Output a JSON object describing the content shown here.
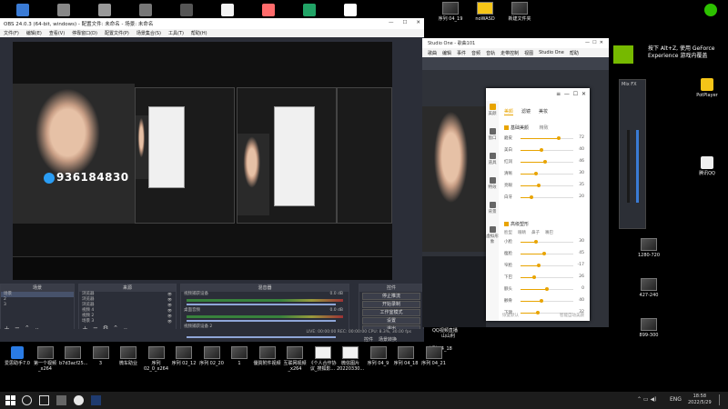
{
  "desktop_top": [
    {
      "label": "",
      "color": "#3a7bd5"
    },
    {
      "label": "",
      "color": "#888"
    },
    {
      "label": "",
      "color": "#999"
    },
    {
      "label": "",
      "color": "#777"
    },
    {
      "label": "",
      "color": "#555"
    },
    {
      "label": "",
      "color": "#f2f2f2"
    },
    {
      "label": "",
      "color": "#ff6b6b"
    },
    {
      "label": "",
      "color": "#21a366"
    },
    {
      "label": "",
      "color": "#ffffff"
    }
  ],
  "desktop_top_right": [
    {
      "label": "序列 04_19"
    },
    {
      "label": "noWASD"
    },
    {
      "label": "新建文件夹"
    }
  ],
  "obs": {
    "title": "OBS 24.0.3 (64-bit, windows) - 配置文件: 未命名 - 场景: 未命名",
    "menu": [
      "文件(F)",
      "编辑(E)",
      "查看(V)",
      "停靠窗口(D)",
      "配置文件(P)",
      "场景集合(S)",
      "工具(T)",
      "帮助(H)"
    ],
    "overlay_text": "936184830",
    "docks": {
      "scenes_title": "场景",
      "sources_title": "来源",
      "mixer_title": "混音器",
      "controls_title": "控件",
      "scenes": [
        "场景",
        "2",
        "3"
      ],
      "sources": [
        "浏览器",
        "浏览器",
        "浏览器",
        "视频 4",
        "视频 2",
        "场景 3"
      ],
      "mixer": [
        {
          "name": "视频捕获设备",
          "value": "0.0 dB"
        },
        {
          "name": "桌面音频",
          "value": "0.0 dB"
        },
        {
          "name": "视频捕获设备 2",
          "value": ""
        }
      ],
      "controls": [
        "停止推流",
        "开始录制",
        "工作室模式",
        "设置",
        "退出"
      ],
      "bottom_tabs": [
        "控件",
        "场景转换"
      ]
    },
    "status": "LIVE: 00:00:00   REC: 00:00:00   CPU: 8.3%, 30.00 fps"
  },
  "studio": {
    "title": "Studio One - 歌曲101",
    "menu": [
      "歌曲",
      "编辑",
      "事件",
      "音频",
      "音轨",
      "走带控制",
      "视图",
      "Studio One",
      "帮助"
    ]
  },
  "beauty": {
    "tabs": [
      "美颜",
      "滤镜",
      "美妆"
    ],
    "side": [
      "美颜",
      "窗口",
      "道具",
      "特效",
      "背景",
      "虚拟形象"
    ],
    "section1": "基础美颜",
    "section1_mode": "精致",
    "section2": "高级塑形",
    "section2_tabs": [
      "脸型",
      "眼睛",
      "鼻子",
      "嘴巴"
    ],
    "sliders1": [
      {
        "label": "磨皮",
        "value": "72",
        "level": 0.72
      },
      {
        "label": "美白",
        "value": "40",
        "level": 0.4
      },
      {
        "label": "红润",
        "value": "46",
        "level": 0.46
      },
      {
        "label": "清晰",
        "value": "30",
        "level": 0.3
      },
      {
        "label": "亮眼",
        "value": "35",
        "level": 0.35
      },
      {
        "label": "白牙",
        "value": "20",
        "level": 0.2
      }
    ],
    "sliders2": [
      {
        "label": "小脸",
        "value": "30",
        "level": 0.3
      },
      {
        "label": "瘦脸",
        "value": "45",
        "level": 0.45
      },
      {
        "label": "窄脸",
        "value": "-17",
        "level": 0.35
      },
      {
        "label": "下巴",
        "value": "26",
        "level": 0.26
      },
      {
        "label": "额头",
        "value": "0",
        "level": 0.5
      },
      {
        "label": "颧骨",
        "value": "40",
        "level": 0.4
      },
      {
        "label": "下颌",
        "value": "32",
        "level": 0.32
      }
    ],
    "footer_left": "恢复默认",
    "footer_right": "智能自动美颜"
  },
  "nvidia": {
    "text": "按下 Alt+Z, 使用 GeForce Experience 游戏内覆盖"
  },
  "mixfx": {
    "label": "Mix FX"
  },
  "right_icons": [
    {
      "label": "PotPlayer",
      "color": "#f5c518"
    },
    {
      "label": "腾讯QQ",
      "color": "#eee"
    }
  ],
  "right_thumbs": [
    "1280-720",
    "427-240",
    "899-300"
  ],
  "mid_labels": [
    "序列 04_18",
    "QQ视频直播",
    "山山利"
  ],
  "desktop_bottom": [
    {
      "label": "爱思助手7.0"
    },
    {
      "label": "第一个视频 _x264"
    },
    {
      "label": "b7d3acf25..."
    },
    {
      "label": "3"
    },
    {
      "label": "微车助业"
    },
    {
      "label": "序列 02_0_x264"
    },
    {
      "label": "序列 02_12"
    },
    {
      "label": "序列 02_20"
    },
    {
      "label": "1"
    },
    {
      "label": "優質附件视频"
    },
    {
      "label": "互联网视频 _x264"
    },
    {
      "label": "《个人合作协议_搜狐影..."
    },
    {
      "label": "微信图片 20220330..."
    },
    {
      "label": "序列 04_9"
    },
    {
      "label": "序列 04_18"
    },
    {
      "label": "序列 04_21"
    }
  ],
  "taskbar": {
    "lang": "ENG",
    "time": "18:58",
    "date": "2022/5/29"
  }
}
